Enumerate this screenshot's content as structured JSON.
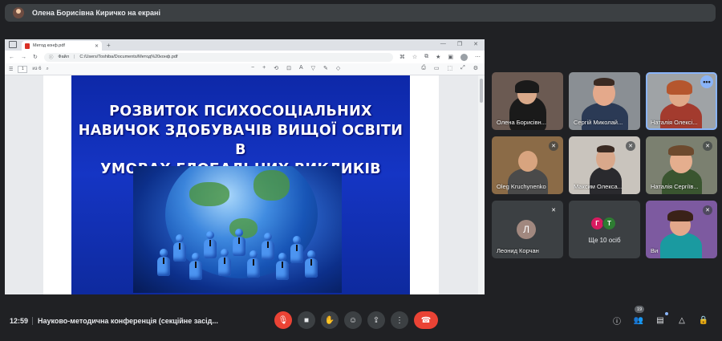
{
  "banner": {
    "presenter_text": "Олена Борисівна Киричко на екрані"
  },
  "browser": {
    "tab_title": "Метод конф.pdf",
    "address_label": "Файл",
    "address_path": "C:/Users/Toshiba/Documents/Метод%20конф.pdf",
    "page_number": "1",
    "page_of": "из 6"
  },
  "slide": {
    "title_line1": "РОЗВИТОК ПСИХОСОЦІАЛЬНИХ",
    "title_line2": "НАВИЧОК ЗДОБУВАЧІВ ВИЩОЇ ОСВІТИ В",
    "title_line3": "УМОВАХ ГЛОБАЛЬНИХ ВИКЛИКІВ"
  },
  "participants": [
    {
      "name": "Олена Борисівн...",
      "muted": false
    },
    {
      "name": "Сергій Миколай...",
      "muted": false
    },
    {
      "name": "Наталія Олексі...",
      "muted": false,
      "active": true
    },
    {
      "name": "Oleg Kruchynenko",
      "muted": true
    },
    {
      "name": "Максим Олекса...",
      "muted": true
    },
    {
      "name": "Наталія Сергіїв...",
      "muted": true
    },
    {
      "name": "Леонид Корчан",
      "muted": true,
      "initial": "Л"
    },
    {
      "name": "Ви",
      "muted": true
    }
  ],
  "more_tile": {
    "label": "Ще 10 осіб",
    "avatars": [
      "Г",
      "Т"
    ]
  },
  "bottom": {
    "time": "12:59",
    "meeting_title": "Науково-методична конференція (секційне засід...",
    "participants_count": "19"
  },
  "colors": {
    "background": "#202124",
    "slide_blue": "#1535c4",
    "mic_off_red": "#ea4335",
    "accent": "#8ab4f8"
  }
}
